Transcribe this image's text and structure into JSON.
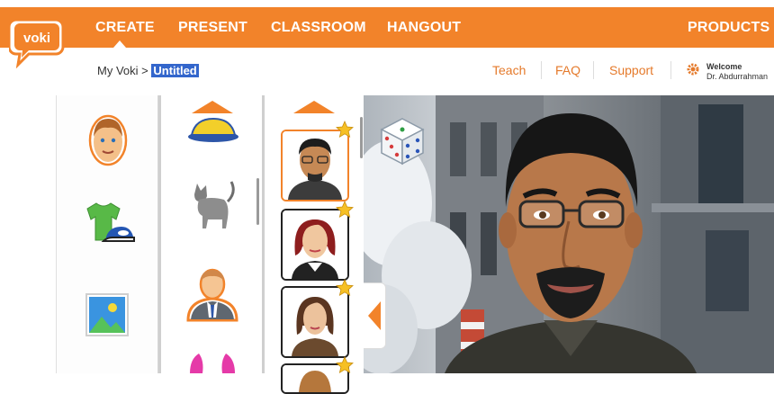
{
  "app": {
    "logo_text": "voki"
  },
  "nav": {
    "items": [
      "CREATE",
      "PRESENT",
      "CLASSROOM",
      "HANGOUT"
    ],
    "products": "PRODUCTS"
  },
  "breadcrumb": {
    "root": "My Voki",
    "sep": ">",
    "current": "Untitled"
  },
  "links": {
    "teach": "Teach",
    "faq": "FAQ",
    "support": "Support"
  },
  "user": {
    "welcome": "Welcome",
    "name": "Dr. Abdurrahman"
  },
  "colors": {
    "accent": "#f2832a",
    "highlight": "#3366cc"
  },
  "icons": {
    "categories": [
      "character-head-icon",
      "clothing-icon",
      "background-icon"
    ],
    "subcategories": [
      "hat-icon",
      "cat-icon",
      "business-person-icon",
      "bunny-ears-icon"
    ],
    "random": "dice-icon"
  }
}
